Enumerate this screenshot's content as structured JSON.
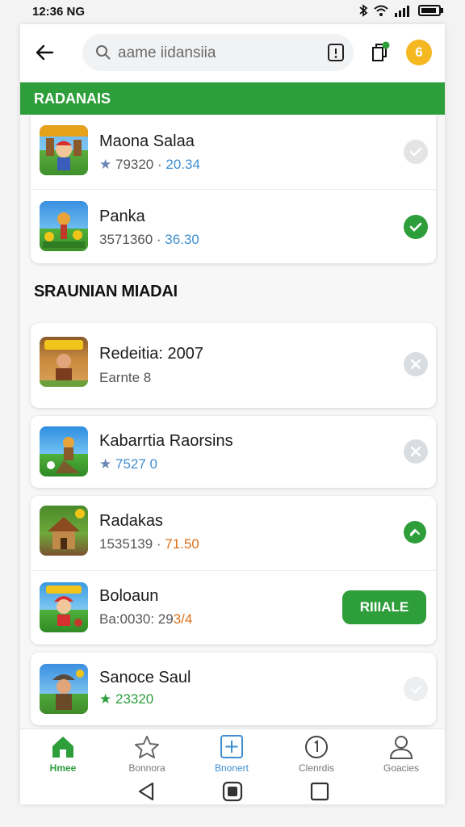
{
  "status_bar": {
    "time": "12:36 NG"
  },
  "header": {
    "search_placeholder": "aame iidansiia",
    "coin_label": "6"
  },
  "banner": {
    "title": "RADANAIS"
  },
  "top_apps": [
    {
      "title": "Maona Salaa",
      "sub_star": "★",
      "sub_main": "79320",
      "sub_sep": " · ",
      "sub_hl": "20.34",
      "status": "unchecked"
    },
    {
      "title": "Panka",
      "sub_star": "",
      "sub_main": "3571360",
      "sub_sep": " · ",
      "sub_hl": "36.30",
      "status": "checked"
    }
  ],
  "section_heading": "SRAUNIAN MIADAI",
  "apps": [
    {
      "title": "Redeitia: 2007",
      "sub": "Earnte 8",
      "action": "close"
    },
    {
      "title": "Kabarrtia Raorsins",
      "sub_star": "★",
      "sub": "7527 0",
      "action": "close"
    },
    {
      "title": "Radakas",
      "sub": "1535139 · ",
      "sub_hl": "71.50",
      "action": "collapse"
    },
    {
      "title": "Boloaun",
      "sub": "Ba:0030: 29",
      "sub_hl": "3/4",
      "action_label": "RIIIALE"
    },
    {
      "title": "Sanoce Saul",
      "sub_star": "★",
      "sub": "23320",
      "action": "pending"
    }
  ],
  "nav": [
    {
      "label": "Hmee",
      "icon": "home-icon",
      "active": true
    },
    {
      "label": "Bonnora",
      "icon": "star-icon"
    },
    {
      "label": "Bnonert",
      "icon": "plus-box-icon"
    },
    {
      "label": "Clenrdis",
      "icon": "info-circle-icon"
    },
    {
      "label": "Goacies",
      "icon": "person-icon"
    }
  ],
  "colors": {
    "accent": "#2e9e3b",
    "coin": "#f5b820",
    "banner_text": "#ffffff"
  }
}
